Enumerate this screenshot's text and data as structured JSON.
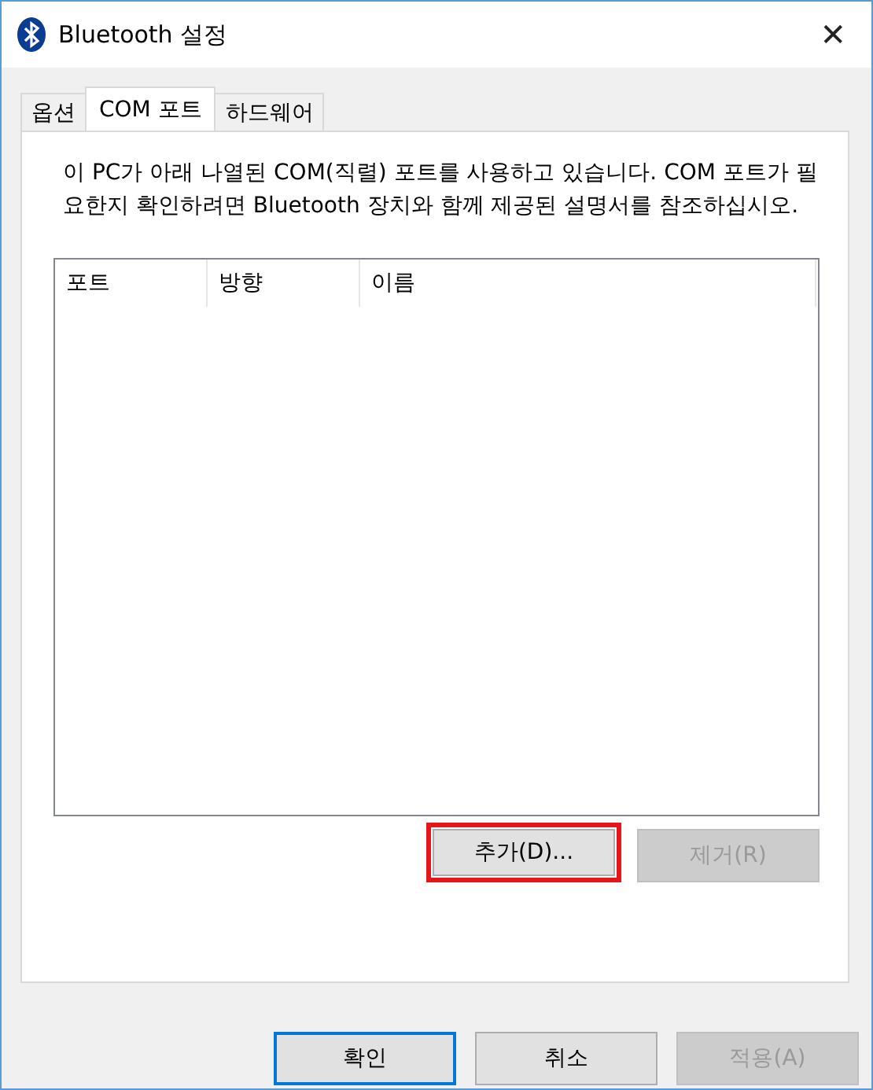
{
  "window": {
    "title": "Bluetooth 설정",
    "close": "✕"
  },
  "tabs": [
    {
      "label": "옵션",
      "selected": false
    },
    {
      "label": "COM 포트",
      "selected": true
    },
    {
      "label": "하드웨어",
      "selected": false
    }
  ],
  "description": "이 PC가 아래 나열된 COM(직렬) 포트를 사용하고 있습니다. COM 포트가 필요한지 확인하려면 Bluetooth 장치와 함께 제공된 설명서를 참조하십시오.",
  "table": {
    "columns": [
      "포트",
      "방향",
      "이름"
    ]
  },
  "panel_buttons": [
    {
      "label": "추가(D)...",
      "disabled": false,
      "highlighted": true
    },
    {
      "label": "제거(R)",
      "disabled": true,
      "highlighted": false
    }
  ],
  "dialog_buttons": [
    {
      "label": "확인",
      "disabled": false,
      "default": true
    },
    {
      "label": "취소",
      "disabled": false,
      "default": false
    },
    {
      "label": "적용(A)",
      "disabled": true,
      "default": false
    }
  ]
}
